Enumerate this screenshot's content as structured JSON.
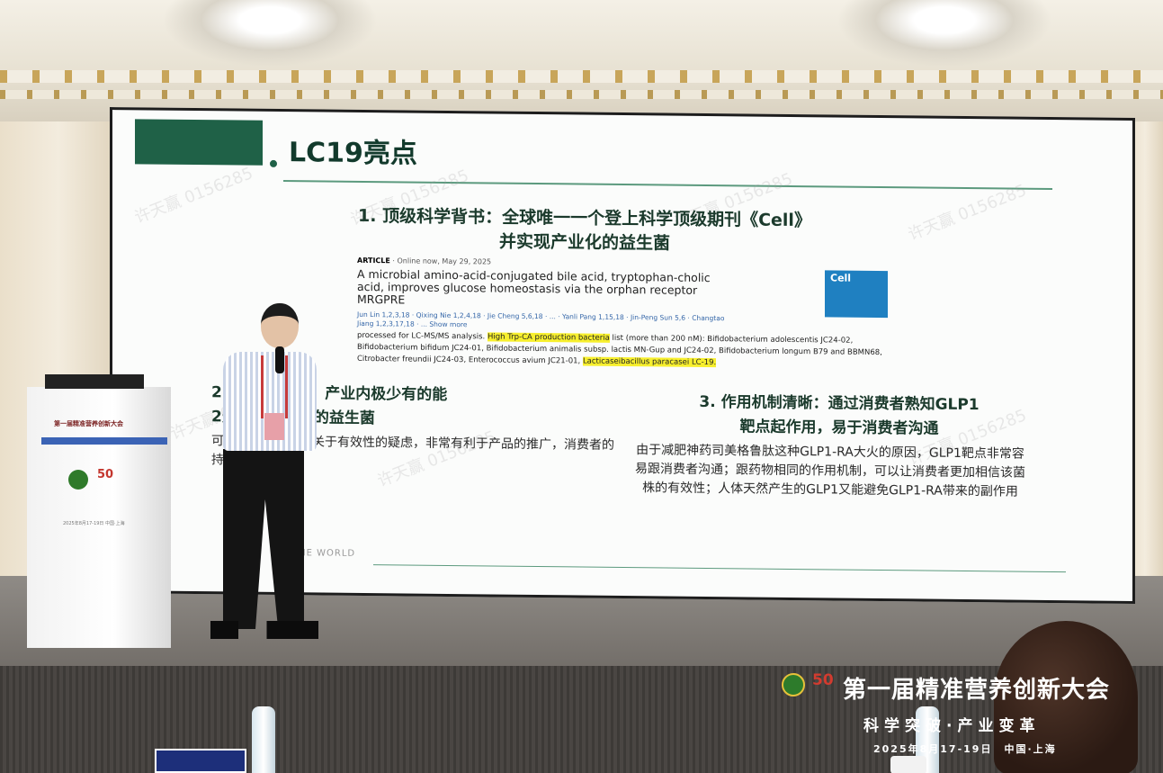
{
  "slide": {
    "title": "LC19亮点",
    "heading1_line1": "1. 顶级科学背书：全球唯一一个登上科学顶级期刊《Cell》",
    "heading1_line2": "并实现产业化的益生菌",
    "paper": {
      "article_tag": "ARTICLE",
      "date": "· Online now, May 29, 2025",
      "title": "A microbial amino-acid-conjugated bile acid, tryptophan-cholic acid, improves glucose homeostasis via the orphan receptor MRGPRE",
      "authors": "Jun Lin 1,2,3,18 · Qixing Nie 1,2,4,18 · Jie Cheng 5,6,18 · ... · Yanli Pang 1,15,18 · Jin-Peng Sun 5,6 · Changtao Jiang 1,2,3,17,18 · ... Show more",
      "body_prefix": "processed for LC-MS/MS analysis.",
      "body_highlight1": "High Trp-CA production bacteria",
      "body_middle": " list (more than 200 nM): Bifidobacterium adolescentis JC24-02, Bifidobacterium bifidum JC24-01, Bifidobacterium animalis subsp. lactis MN-Gup and JC24-02, Bifidobacterium longum B79 and BBMN68, Citrobacter freundii JC24-03, Enterococcus avium JC21-01,",
      "body_highlight2": "Lacticaseibacillus paracasei LC-19.",
      "journal_logo": "Cell"
    },
    "heading2_line1": "2. 消费者体感：产业内极少有的能",
    "heading2_line2": "2天内提供体感的益生菌",
    "body2": "可以打消消费者的关于有效性的疑虑，非常有利于产品的推广，消费者的持续使用及复购",
    "heading3_line1": "3. 作用机制清晰：通过消费者熟知GLP1",
    "heading3_line2": "靶点起作用，易于消费者沟通",
    "body3": "由于减肥神药司美格鲁肽这种GLP1-RA大火的原因，GLP1靶点非常容易跟消费者沟通；跟药物相同的作用机制，可以让消费者更加相信该菌株的有效性；人体天然产生的GLP1又能避免GLP1-RA带来的副作用",
    "footer_text": "THE WORLD",
    "watermark": "许天赢 0156285"
  },
  "podium": {
    "title": "第一届精准营养创新大会",
    "date": "2025年8月17-19日 中国·上海"
  },
  "banner": {
    "logo_number": "50",
    "title": "第一届精准营养创新大会",
    "slogan": "科学突破·产业变革",
    "date_place": "2025年8月17-19日　中国·上海"
  },
  "colors": {
    "slide_green": "#1f6147",
    "highlight": "#f7ef2d",
    "cell_blue": "#1f80c1"
  }
}
